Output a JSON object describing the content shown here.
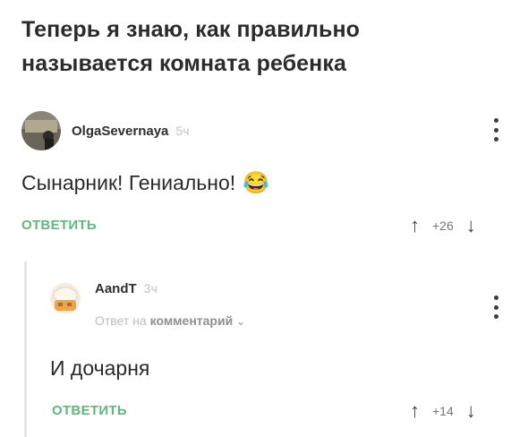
{
  "post": {
    "title": "Теперь я знаю, как правильно называется комната ребенка"
  },
  "comments": [
    {
      "username": "OlgaSevernaya",
      "time": "5ч",
      "text": "Сынарник! Гениально!",
      "emoji": "😂",
      "reply_label": "ОТВЕТИТЬ",
      "score": "+26"
    },
    {
      "username": "AandT",
      "time": "3ч",
      "reply_prefix": "Ответ на",
      "reply_target": "комментарий",
      "reply_chevron": "⌄",
      "text": "И дочарня",
      "reply_label": "ОТВЕТИТЬ",
      "score": "+14"
    }
  ],
  "icons": {
    "upvote": "↑",
    "downvote": "↓"
  },
  "colors": {
    "accent_green": "#5fb87d",
    "muted_text": "#c3c3c3"
  }
}
